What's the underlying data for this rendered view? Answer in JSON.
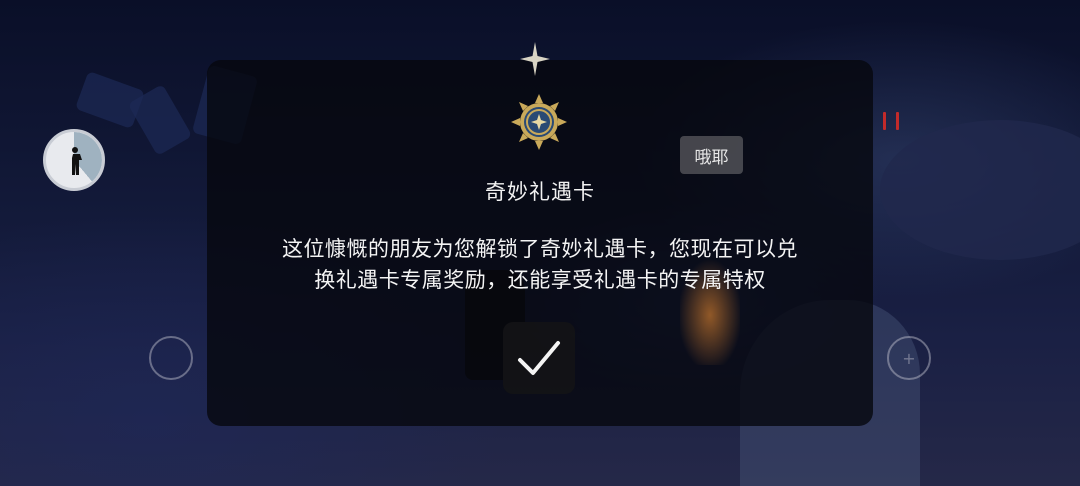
{
  "colors": {
    "dialog_bg": "#06080e",
    "text": "#f2f2f2",
    "emblem_gold": "#c9a95a",
    "emblem_blue": "#3e6fa6"
  },
  "icons": {
    "sparkle": "four-point-star-icon",
    "emblem": "sun-medallion-icon",
    "confirm": "checkmark-icon",
    "clock": "clock-person-icon"
  },
  "name_tag": {
    "text": "哦耶"
  },
  "dialog": {
    "title": "奇妙礼遇卡",
    "body_line1": "这位慷慨的朋友为您解锁了奇妙礼遇卡，您现在可以兑",
    "body_line2": "换礼遇卡专属奖励，还能享受礼遇卡的专属特权"
  }
}
